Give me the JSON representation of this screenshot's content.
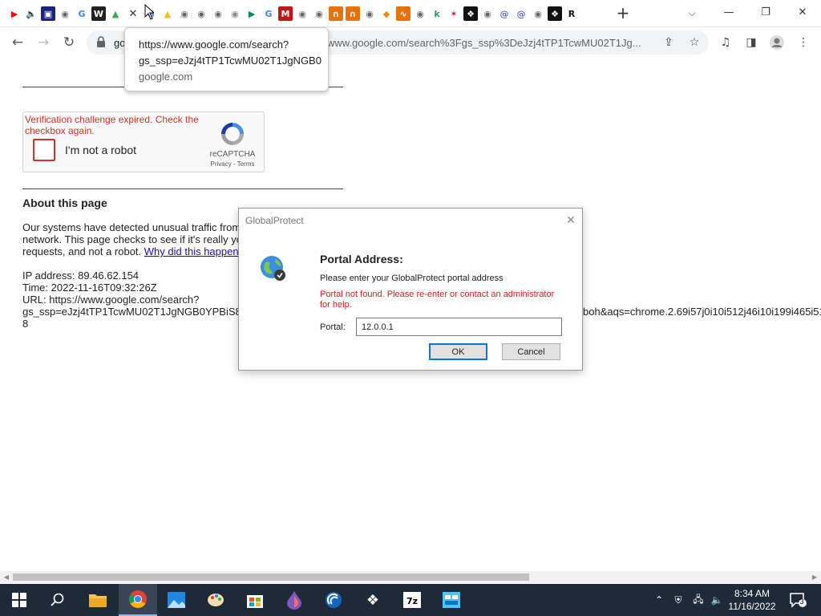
{
  "browser": {
    "tabs": [
      {
        "icon": "youtube-icon",
        "glyph": "▶",
        "color": "#ff0000",
        "bg": "#fff"
      },
      {
        "icon": "speaker-icon",
        "glyph": "🔈",
        "color": "#444",
        "bg": "#fff"
      },
      {
        "icon": "app-icon",
        "glyph": "▣",
        "color": "#fff",
        "bg": "#1a237e"
      },
      {
        "icon": "globe-icon",
        "glyph": "◉",
        "color": "#666",
        "bg": "#fff"
      },
      {
        "icon": "google-icon",
        "glyph": "G",
        "color": "#4285f4",
        "bg": "#fff"
      },
      {
        "icon": "w-icon",
        "glyph": "W",
        "color": "#fff",
        "bg": "#222"
      },
      {
        "icon": "drive-icon",
        "glyph": "▲",
        "color": "#34a853",
        "bg": "#fff"
      },
      {
        "icon": "close-tab-icon",
        "glyph": "✕",
        "color": "#333",
        "bg": "#fff",
        "active": true
      },
      {
        "icon": "google-icon",
        "glyph": "G",
        "color": "#4285f4",
        "bg": "#fff"
      },
      {
        "icon": "drive-icon",
        "glyph": "▲",
        "color": "#fbbc05",
        "bg": "#fff"
      },
      {
        "icon": "globe-icon",
        "glyph": "◉",
        "color": "#666",
        "bg": "#fff"
      },
      {
        "icon": "globe-icon",
        "glyph": "◉",
        "color": "#666",
        "bg": "#fff"
      },
      {
        "icon": "globe-icon",
        "glyph": "◉",
        "color": "#666",
        "bg": "#fff"
      },
      {
        "icon": "globe-icon",
        "glyph": "◉",
        "color": "#888",
        "bg": "#fff"
      },
      {
        "icon": "play-store-icon",
        "glyph": "▶",
        "color": "#01875f",
        "bg": "#fff"
      },
      {
        "icon": "google-icon",
        "glyph": "G",
        "color": "#4285f4",
        "bg": "#fff"
      },
      {
        "icon": "mcafee-icon",
        "glyph": "M",
        "color": "#fff",
        "bg": "#c01818"
      },
      {
        "icon": "globe-icon",
        "glyph": "◉",
        "color": "#666",
        "bg": "#fff"
      },
      {
        "icon": "globe-icon",
        "glyph": "◉",
        "color": "#666",
        "bg": "#fff"
      },
      {
        "icon": "keyhole-icon",
        "glyph": "∩",
        "color": "#fff",
        "bg": "#e8710a"
      },
      {
        "icon": "keyhole-icon",
        "glyph": "∩",
        "color": "#fff",
        "bg": "#e8710a"
      },
      {
        "icon": "globe-icon",
        "glyph": "◉",
        "color": "#666",
        "bg": "#fff"
      },
      {
        "icon": "cube-icon",
        "glyph": "◆",
        "color": "#ff8c00",
        "bg": "#fff"
      },
      {
        "icon": "chart-icon",
        "glyph": "∿",
        "color": "#fff",
        "bg": "#e8710a"
      },
      {
        "icon": "globe-icon",
        "glyph": "◉",
        "color": "#666",
        "bg": "#fff"
      },
      {
        "icon": "k-icon",
        "glyph": "k",
        "color": "#1aa260",
        "bg": "#fff"
      },
      {
        "icon": "star-icon",
        "glyph": "✶",
        "color": "#c2185b",
        "bg": "#fff"
      },
      {
        "icon": "grid-icon",
        "glyph": "❖",
        "color": "#fff",
        "bg": "#111"
      },
      {
        "icon": "globe-icon",
        "glyph": "◉",
        "color": "#666",
        "bg": "#fff"
      },
      {
        "icon": "at-icon",
        "glyph": "@",
        "color": "#5c6bc0",
        "bg": "#fff"
      },
      {
        "icon": "at-icon",
        "glyph": "@",
        "color": "#5c6bc0",
        "bg": "#fff"
      },
      {
        "icon": "globe-icon",
        "glyph": "◉",
        "color": "#666",
        "bg": "#fff"
      },
      {
        "icon": "grid-icon",
        "glyph": "❖",
        "color": "#fff",
        "bg": "#111"
      },
      {
        "icon": "r-icon",
        "glyph": "R",
        "color": "#111",
        "bg": "#fff"
      }
    ],
    "omnibox_prefix": "go",
    "omnibox_url": "www.google.com/search%3Fgs_ssp%3DeJzj4tTP1TcwMU02T1Jg..."
  },
  "tooltip": {
    "line1": "https://www.google.com/search?",
    "line2": "gs_ssp=eJzj4tTP1TcwMU02T1JgNGB0",
    "line3": "google.com"
  },
  "captcha": {
    "error": "Verification challenge expired. Check the checkbox again.",
    "label": "I'm not a robot",
    "brand": "reCAPTCHA",
    "terms": "Privacy - Terms"
  },
  "page": {
    "about_title": "About this page",
    "para_line1": "Our systems have detected unusual traffic from",
    "para_line2": "network. This page checks to see if it's really yo",
    "para_line3_pre": "requests, and not a robot.",
    "para_link": "Why did this happen",
    "ip": "IP address: 89.46.62.154",
    "time": "Time: 2022-11-16T09:32:26Z",
    "url_line1": "URL: https://www.google.com/search?",
    "url_line2": "gs_ssp=eJzj4tTP1TcwMU02T1JgNGB0YPBiS8",
    "url_line2_right": "boh&aqs=chrome.2.69i57j0i10i512j46i10i199i465i51",
    "url_line3": "8"
  },
  "dialog": {
    "title": "GlobalProtect",
    "heading": "Portal Address:",
    "prompt": "Please enter your GlobalProtect portal address",
    "error": "Portal not found. Please re-enter or contact an administrator for help.",
    "portal_label": "Portal:",
    "portal_value": "12.0.0.1",
    "ok_label": "OK",
    "cancel_label": "Cancel"
  },
  "taskbar": {
    "time": "8:34 AM",
    "date": "11/16/2022",
    "notification_count": "3"
  }
}
